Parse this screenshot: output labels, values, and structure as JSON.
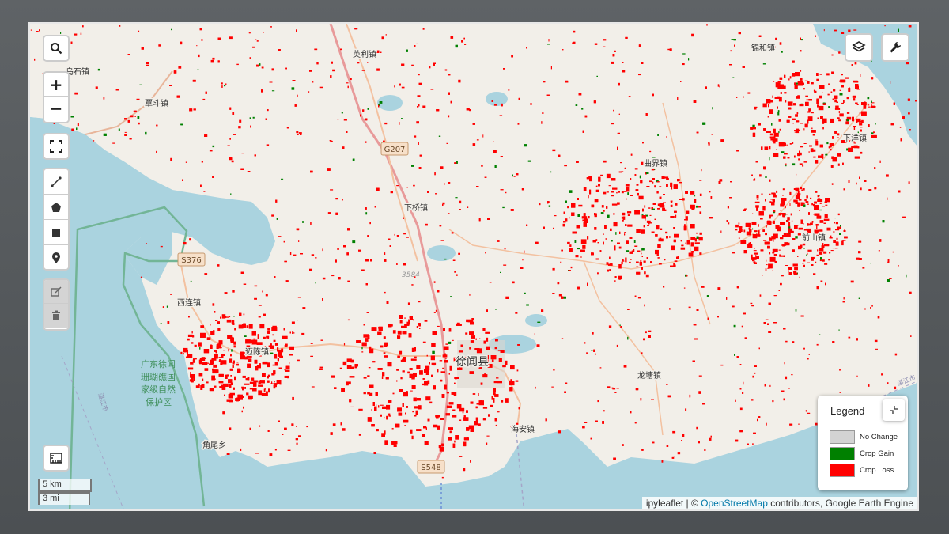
{
  "map": {
    "attribution_prefix": "ipyleaflet | © ",
    "attribution_link": "OpenStreetMap",
    "attribution_suffix": " contributors, Google Earth Engine",
    "scale": {
      "metric": "5 km",
      "imperial": "3 mi"
    },
    "colors": {
      "water": "#aad3df",
      "land": "#f2efe9",
      "crop_gain": "#008000",
      "crop_loss": "#ff0000",
      "no_change": "#d3d3d3"
    }
  },
  "controls": {
    "search": "search-icon",
    "zoom_in": "+",
    "zoom_out": "−",
    "fullscreen": "fullscreen-icon",
    "draw": [
      "polyline-icon",
      "polygon-icon",
      "rectangle-icon",
      "marker-icon"
    ],
    "edit": [
      "edit-icon",
      "delete-icon"
    ],
    "measure": "ruler-icon",
    "layers": "layers-icon",
    "tools": "wrench-icon"
  },
  "places": {
    "wushi": "乌石镇",
    "ying_li": "英利镇",
    "jin_he": "锦和镇",
    "qu_dou": "覃斗镇",
    "xia_yang": "下洋镇",
    "qu_jie": "曲界镇",
    "xia_qiao": "下桥镇",
    "qian_shan": "前山镇",
    "xi_lian": "西连镇",
    "mai_chen": "迈陈镇",
    "xu_wen": "徐闻县",
    "long_tang": "龙塘镇",
    "hai_an": "海安镇",
    "jiao_wei": "角尾乡",
    "reserve_1": "广东徐闻",
    "reserve_2": "珊瑚礁国",
    "reserve_3": "家级自然",
    "reserve_4": "保护区",
    "zhanjiang_w": "湛江市",
    "zhanjiang_e": "湛江市"
  },
  "roads": {
    "g207": "G207",
    "s376": "S376",
    "s548": "S548",
    "r3584": "3584"
  },
  "legend": {
    "title": "Legend",
    "items": [
      {
        "label": "No Change",
        "color": "#d3d3d3"
      },
      {
        "label": "Crop Gain",
        "color": "#008000"
      },
      {
        "label": "Crop Loss",
        "color": "#ff0000"
      }
    ]
  }
}
